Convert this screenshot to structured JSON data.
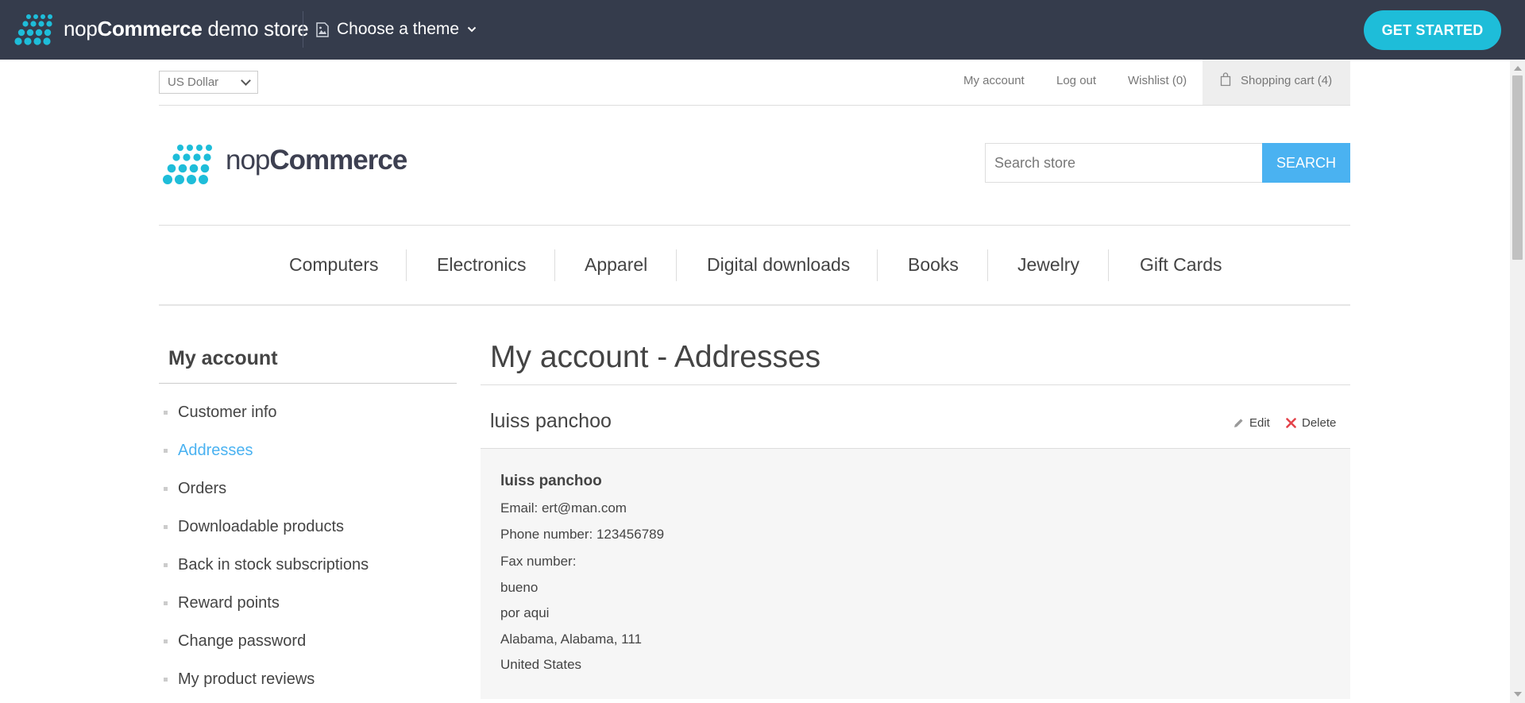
{
  "demo_bar": {
    "brand_light": "nop",
    "brand_bold": "Commerce",
    "brand_suffix": " demo store",
    "theme_chooser": "Choose a theme",
    "get_started": "GET STARTED"
  },
  "header": {
    "currency": "US Dollar",
    "links": {
      "my_account": "My account",
      "log_out": "Log out",
      "wishlist": "Wishlist (0)",
      "shopping_cart": "Shopping cart (4)"
    },
    "store_name_light": "nop",
    "store_name_bold": "Commerce",
    "search_placeholder": "Search store",
    "search_button": "SEARCH"
  },
  "menu": [
    "Computers",
    "Electronics",
    "Apparel",
    "Digital downloads",
    "Books",
    "Jewelry",
    "Gift Cards"
  ],
  "side_nav": {
    "title": "My account",
    "items": [
      "Customer info",
      "Addresses",
      "Orders",
      "Downloadable products",
      "Back in stock subscriptions",
      "Reward points",
      "Change password",
      "My product reviews"
    ],
    "active": "Addresses"
  },
  "main": {
    "page_title": "My account - Addresses",
    "address": {
      "title": "luiss panchoo",
      "edit": "Edit",
      "delete": "Delete",
      "name": "luiss panchoo",
      "email": "Email: ert@man.com",
      "phone": "Phone number: 123456789",
      "fax": "Fax number:",
      "company": "bueno",
      "street": "por aqui",
      "city_state_zip": "Alabama, Alabama, 111",
      "country": "United States"
    }
  },
  "colors": {
    "demo_bar_bg": "#353c4c",
    "get_started_bg": "#1ebdd9",
    "accent_blue": "#4ab2f1",
    "logo_dots": "#1ebdd9",
    "delete_red": "#e4434b"
  }
}
